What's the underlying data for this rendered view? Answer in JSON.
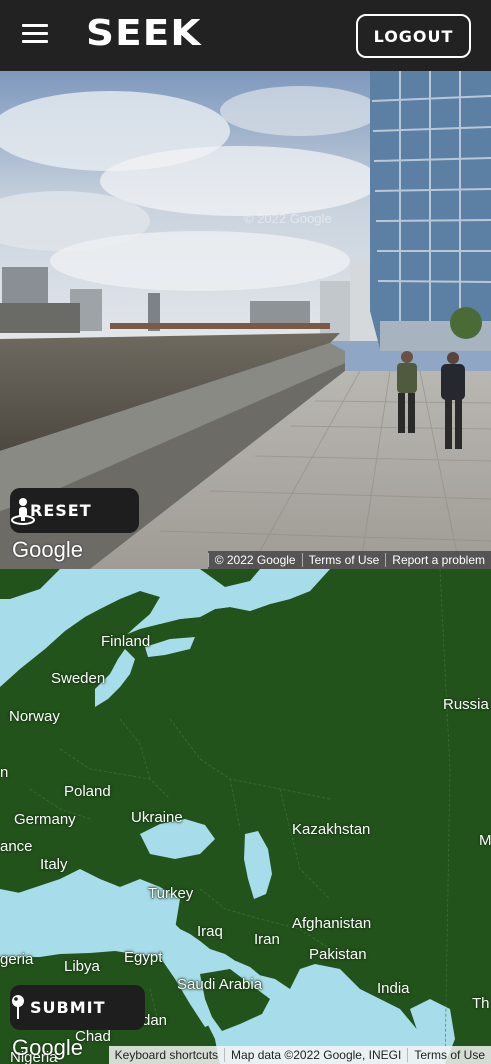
{
  "header": {
    "logo": "SEEK",
    "logout_label": "LOGOUT"
  },
  "streetview": {
    "reset_label": "RESET",
    "google_logo": "Google",
    "watermark": "© 2022 Google",
    "attribution": [
      "© 2022 Google",
      "Terms of Use",
      "Report a problem"
    ]
  },
  "map": {
    "submit_label": "SUBMIT",
    "google_logo": "Google",
    "attribution": [
      "Keyboard shortcuts",
      "Map data ©2022 Google, INEGI",
      "Terms of Use"
    ],
    "labels": [
      "Finland",
      "Sweden",
      "Norway",
      "Russia",
      "n",
      "Poland",
      "Germany",
      "Ukraine",
      "Kazakhstan",
      "ance",
      "M",
      "Italy",
      "Turkey",
      "Iraq",
      "Iran",
      "Afghanistan",
      "geria",
      "Libya",
      "Egypt",
      "Pakistan",
      "Saudi Arabia",
      "India",
      "Th",
      "Chad",
      "dan",
      "Nigeria"
    ]
  },
  "colors": {
    "header_bg": "#222222",
    "land": "#22531b",
    "water": "#a7dcea",
    "button_bg": "#1e1e1e"
  }
}
